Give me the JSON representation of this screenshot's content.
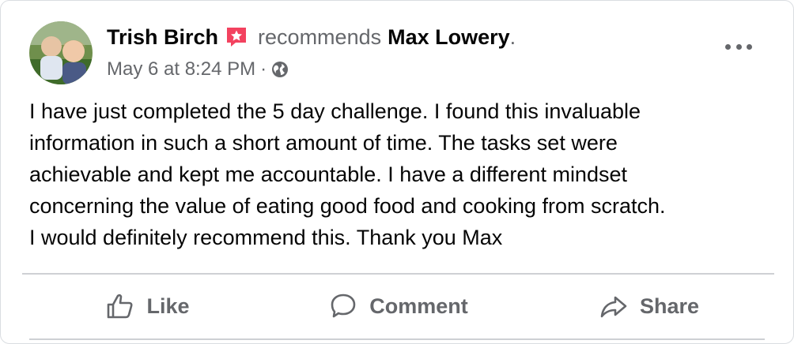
{
  "post": {
    "author": "Trish Birch",
    "action": "recommends",
    "target": "Max Lowery",
    "period": ".",
    "time": "May 6 at 8:24 PM",
    "separator": "·",
    "body": "I have just completed the 5 day challenge. I found this invaluable\ninformation in such a short amount of time. The tasks set were\nachievable and kept me accountable. I have a different mindset\nconcerning the value of eating good food and cooking from scratch.\nI would definitely recommend this. Thank you Max"
  },
  "actions": {
    "like": "Like",
    "comment": "Comment",
    "share": "Share"
  },
  "icons": {
    "recommendation": "recommendation-star-icon",
    "privacy": "globe-icon",
    "more": "more-options-icon",
    "like": "thumbs-up-icon",
    "comment": "comment-bubble-icon",
    "share": "share-arrow-icon"
  },
  "colors": {
    "primary_text": "#050505",
    "secondary_text": "#65676b",
    "recommendation_pink": "#f3425f",
    "divider": "#ced0d4"
  }
}
